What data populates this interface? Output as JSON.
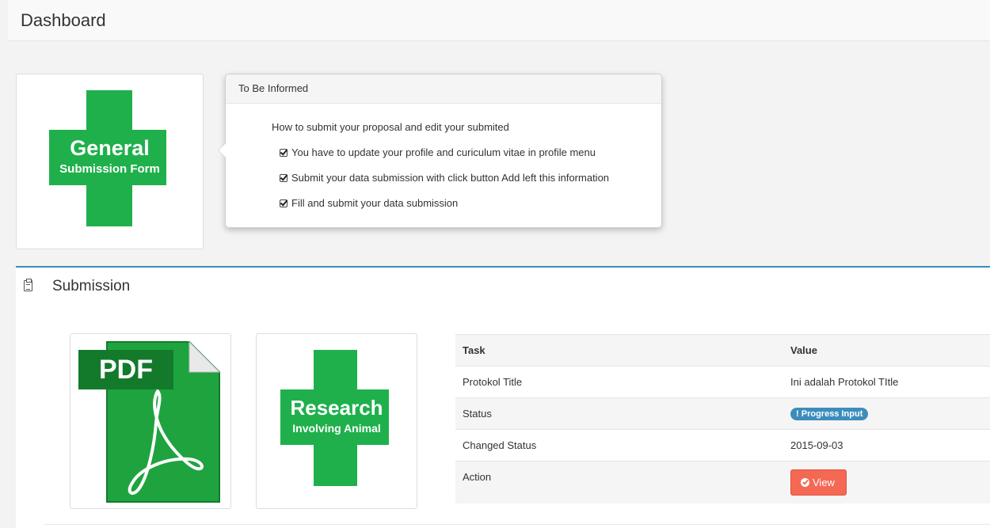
{
  "header": {
    "title": "Dashboard"
  },
  "general_form_logo": {
    "line1": "General",
    "line2": "Submission Form",
    "color": "#1fb04c"
  },
  "popover": {
    "title": "To Be Informed",
    "intro": "How to submit your proposal and edit your submited",
    "items": [
      "You have to update your profile and curiculum vitae in profile menu",
      "Submit your data submission with click button Add left this information",
      "Fill and submit your data submission"
    ],
    "check_icon": "check-square-icon"
  },
  "submission": {
    "title": "Submission",
    "title_icon": "clipboard-icon",
    "pdf_logo": {
      "label": "PDF",
      "color": "#1fb04c"
    },
    "research_logo": {
      "line1": "Research",
      "line2": "Involving Animal",
      "color": "#1fb04c"
    },
    "table": {
      "headers": [
        "Task",
        "Value"
      ],
      "rows": [
        {
          "task": "Protokol Title",
          "value": "Ini adalah Protokol TItle"
        },
        {
          "task": "Status",
          "value": "Progress Input",
          "badge_prefix": "!"
        },
        {
          "task": "Changed Status",
          "value": "2015-09-03"
        },
        {
          "task": "Action",
          "button": "View"
        }
      ]
    },
    "badge_color": "#3c8dbc",
    "button_color": "#f56954"
  }
}
